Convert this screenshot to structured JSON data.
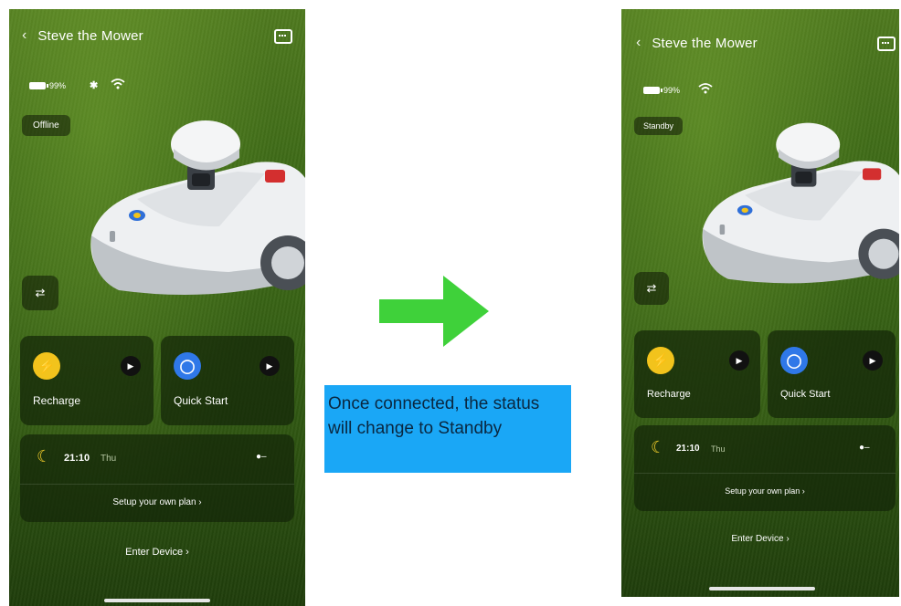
{
  "before": {
    "header": {
      "back_icon": "‹",
      "title": "Steve the Mower",
      "chat_icon": "chat-bubble-icon"
    },
    "status": {
      "battery_percent": "99%",
      "bluetooth_icon": "✱",
      "wifi_icon": "wifi-icon"
    },
    "badge": "Offline",
    "filter_icon": "⇄",
    "cards": [
      {
        "icon": "⚡",
        "label": "Recharge",
        "play": "▶"
      },
      {
        "icon": "◯",
        "label": "Quick Start",
        "play": "▶"
      }
    ],
    "schedule": {
      "moon_icon": "☾",
      "time": "21:10",
      "day": "Thu",
      "toggle": "●–",
      "setup_link": "Setup your own plan ›"
    },
    "enter_device": "Enter Device ›"
  },
  "transition": {
    "arrow_color": "#3fd13a",
    "note": "Once connected, the status will change to Standby",
    "note_bg": "#1aa7f6"
  },
  "after": {
    "header": {
      "back_icon": "‹",
      "title": "Steve the Mower",
      "chat_icon": "chat-bubble-icon"
    },
    "status": {
      "battery_percent": "99%",
      "wifi_icon": "wifi-icon"
    },
    "badge": "Standby",
    "filter_icon": "⇄",
    "cards": [
      {
        "icon": "⚡",
        "label": "Recharge",
        "play": "▶"
      },
      {
        "icon": "◯",
        "label": "Quick Start",
        "play": "▶"
      }
    ],
    "schedule": {
      "moon_icon": "☾",
      "time": "21:10",
      "day": "Thu",
      "toggle": "●–",
      "setup_link": "Setup your own plan ›"
    },
    "enter_device": "Enter Device ›"
  }
}
